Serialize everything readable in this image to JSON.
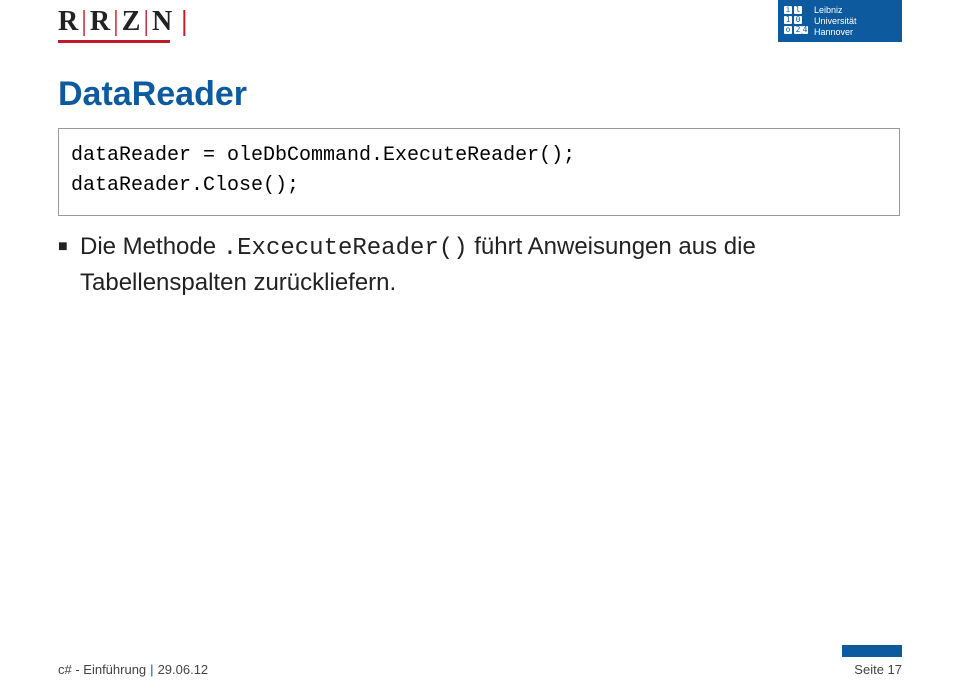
{
  "header": {
    "rrzn_letters": [
      "R",
      "R",
      "Z",
      "N"
    ],
    "luh": {
      "line1": "Leibniz",
      "line2": "Universität",
      "line3": "Hannover"
    }
  },
  "slide": {
    "title": "DataReader",
    "code": "dataReader = oleDbCommand.ExecuteReader();\ndataReader.Close();",
    "bullet": {
      "before": "Die Methode ",
      "method": ".ExcecuteReader()",
      "after": " führt Anweisungen aus die Tabellenspalten zurückliefern."
    }
  },
  "footer": {
    "course": "c# - Einführung",
    "date": "29.06.12",
    "page_label": "Seite 17"
  }
}
